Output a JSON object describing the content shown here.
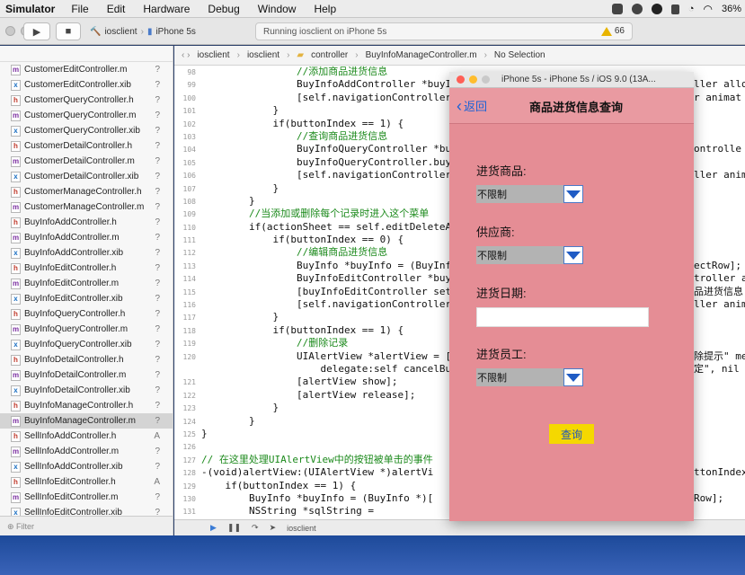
{
  "menubar": {
    "app": "Simulator",
    "menus": [
      "File",
      "Edit",
      "Hardware",
      "Debug",
      "Window",
      "Help"
    ],
    "battery": "36%"
  },
  "toolbar": {
    "scheme_target": "iosclient",
    "scheme_device": "iPhone 5s",
    "status": "Running iosclient on iPhone 5s",
    "warnings": "66"
  },
  "jumpbar": {
    "items": [
      "iosclient",
      "iosclient",
      "controller",
      "BuyInfoManageController.m",
      "No Selection"
    ]
  },
  "navigator": {
    "files": [
      {
        "icon": "m",
        "name": "CustomerEditController.m",
        "status": "?"
      },
      {
        "icon": "x",
        "name": "CustomerEditController.xib",
        "status": "?"
      },
      {
        "icon": "h",
        "name": "CustomerQueryController.h",
        "status": "?"
      },
      {
        "icon": "m",
        "name": "CustomerQueryController.m",
        "status": "?"
      },
      {
        "icon": "x",
        "name": "CustomerQueryController.xib",
        "status": "?"
      },
      {
        "icon": "h",
        "name": "CustomerDetailController.h",
        "status": "?"
      },
      {
        "icon": "m",
        "name": "CustomerDetailController.m",
        "status": "?"
      },
      {
        "icon": "x",
        "name": "CustomerDetailController.xib",
        "status": "?"
      },
      {
        "icon": "h",
        "name": "CustomerManageController.h",
        "status": "?"
      },
      {
        "icon": "m",
        "name": "CustomerManageController.m",
        "status": "?"
      },
      {
        "icon": "h",
        "name": "BuyInfoAddController.h",
        "status": "?"
      },
      {
        "icon": "m",
        "name": "BuyInfoAddController.m",
        "status": "?"
      },
      {
        "icon": "x",
        "name": "BuyInfoAddController.xib",
        "status": "?"
      },
      {
        "icon": "h",
        "name": "BuyInfoEditController.h",
        "status": "?"
      },
      {
        "icon": "m",
        "name": "BuyInfoEditController.m",
        "status": "?"
      },
      {
        "icon": "x",
        "name": "BuyInfoEditController.xib",
        "status": "?"
      },
      {
        "icon": "h",
        "name": "BuyInfoQueryController.h",
        "status": "?"
      },
      {
        "icon": "m",
        "name": "BuyInfoQueryController.m",
        "status": "?"
      },
      {
        "icon": "x",
        "name": "BuyInfoQueryController.xib",
        "status": "?"
      },
      {
        "icon": "h",
        "name": "BuyInfoDetailController.h",
        "status": "?"
      },
      {
        "icon": "m",
        "name": "BuyInfoDetailController.m",
        "status": "?"
      },
      {
        "icon": "x",
        "name": "BuyInfoDetailController.xib",
        "status": "?"
      },
      {
        "icon": "h",
        "name": "BuyInfoManageController.h",
        "status": "?"
      },
      {
        "icon": "m",
        "name": "BuyInfoManageController.m",
        "status": "?",
        "selected": true
      },
      {
        "icon": "h",
        "name": "SellInfoAddController.h",
        "status": "A"
      },
      {
        "icon": "m",
        "name": "SellInfoAddController.m",
        "status": "?"
      },
      {
        "icon": "x",
        "name": "SellInfoAddController.xib",
        "status": "?"
      },
      {
        "icon": "h",
        "name": "SellInfoEditController.h",
        "status": "A"
      },
      {
        "icon": "m",
        "name": "SellInfoEditController.m",
        "status": "?"
      },
      {
        "icon": "x",
        "name": "SellInfoEditController.xib",
        "status": "?"
      }
    ],
    "filter_placeholder": "Filter"
  },
  "code": [
    {
      "n": "98",
      "t": "                //添加商品进货信息",
      "k": "cmt"
    },
    {
      "n": "99",
      "t": "                BuyInfoAddController *buyIr",
      "k": "code"
    },
    {
      "n": "100",
      "t": "                [self.navigationController",
      "k": "code"
    },
    {
      "n": "101",
      "t": "            }",
      "k": "code"
    },
    {
      "n": "102",
      "t": "            if(buttonIndex == 1) {",
      "k": "code"
    },
    {
      "n": "103",
      "t": "                //查询商品进货信息",
      "k": "cmt"
    },
    {
      "n": "104",
      "t": "                BuyInfoQueryController *buy",
      "k": "code"
    },
    {
      "n": "105",
      "t": "                buyInfoQueryController.buyI",
      "k": "code"
    },
    {
      "n": "106",
      "t": "                [self.navigationController",
      "k": "code"
    },
    {
      "n": "107",
      "t": "            }",
      "k": "code"
    },
    {
      "n": "108",
      "t": "        }",
      "k": "code"
    },
    {
      "n": "109",
      "t": "        //当添加或删除每个记录时进入这个菜单",
      "k": "cmt"
    },
    {
      "n": "110",
      "t": "        if(actionSheet == self.editDeleteAc",
      "k": "code"
    },
    {
      "n": "111",
      "t": "            if(buttonIndex == 0) {",
      "k": "code"
    },
    {
      "n": "112",
      "t": "                //编辑商品进货信息",
      "k": "cmt"
    },
    {
      "n": "113",
      "t": "                BuyInfo *buyInfo = (BuyInfo",
      "k": "code"
    },
    {
      "n": "114",
      "t": "                BuyInfoEditController *buyI",
      "k": "code"
    },
    {
      "n": "115",
      "t": "                [buyInfoEditController setB",
      "k": "code"
    },
    {
      "n": "116",
      "t": "                [self.navigationController",
      "k": "code"
    },
    {
      "n": "117",
      "t": "            }",
      "k": "code"
    },
    {
      "n": "118",
      "t": "            if(buttonIndex == 1) {",
      "k": "code"
    },
    {
      "n": "119",
      "t": "                //删除记录",
      "k": "cmt"
    },
    {
      "n": "120",
      "t": "                UIAlertView *alertView = [[",
      "k": "code"
    },
    {
      "n": "",
      "t": "                    delegate:self cancelBut",
      "k": "code"
    },
    {
      "n": "121",
      "t": "                [alertView show];",
      "k": "code"
    },
    {
      "n": "122",
      "t": "                [alertView release];",
      "k": "code"
    },
    {
      "n": "123",
      "t": "            }",
      "k": "code"
    },
    {
      "n": "124",
      "t": "        }",
      "k": "code"
    },
    {
      "n": "125",
      "t": "}",
      "k": "code"
    },
    {
      "n": "126",
      "t": "",
      "k": "code"
    },
    {
      "n": "127",
      "t": "// 在这里处理UIAlertView中的按钮被单击的事件",
      "k": "cmt"
    },
    {
      "n": "128",
      "t": "-(void)alertView:(UIAlertView *)alertVi",
      "k": "code"
    },
    {
      "n": "129",
      "t": "    if(buttonIndex == 1) {",
      "k": "code"
    },
    {
      "n": "130",
      "t": "        BuyInfo *buyInfo = (BuyInfo *)[",
      "k": "code"
    },
    {
      "n": "131",
      "t": "        NSString *sqlString =",
      "k": "code"
    }
  ],
  "code_right": [
    {
      "line": 1,
      "t": "ller allo"
    },
    {
      "line": 2,
      "t": "r animat"
    },
    {
      "line": 6,
      "t": "ontrolle"
    },
    {
      "line": 8,
      "t": "ller anim"
    },
    {
      "line": 15,
      "t": "ectRow];"
    },
    {
      "line": 16,
      "t": "troller a"
    },
    {
      "line": 17,
      "t": "品进货信息"
    },
    {
      "line": 18,
      "t": "ller animat"
    },
    {
      "line": 22,
      "t": "除提示\" me"
    },
    {
      "line": 23,
      "t": "定\", nil"
    },
    {
      "line": 31,
      "t": "ttonIndex"
    },
    {
      "line": 33,
      "t": "Row];"
    }
  ],
  "debugbar": {
    "target": "iosclient"
  },
  "simulator": {
    "title": "iPhone 5s - iPhone 5s / iOS 9.0 (13A...",
    "back_label": "返回",
    "page_title": "商品进货信息查询",
    "fields": {
      "product_label": "进货商品:",
      "product_value": "不限制",
      "supplier_label": "供应商:",
      "supplier_value": "不限制",
      "date_label": "进货日期:",
      "date_value": "",
      "staff_label": "进货员工:",
      "staff_value": "不限制"
    },
    "query_button": "查询"
  },
  "colors": {
    "sim_bg": "#e58d95",
    "query_button": "#f5d800",
    "back_link": "#1a62d6",
    "comment": "#1c8a1c"
  }
}
